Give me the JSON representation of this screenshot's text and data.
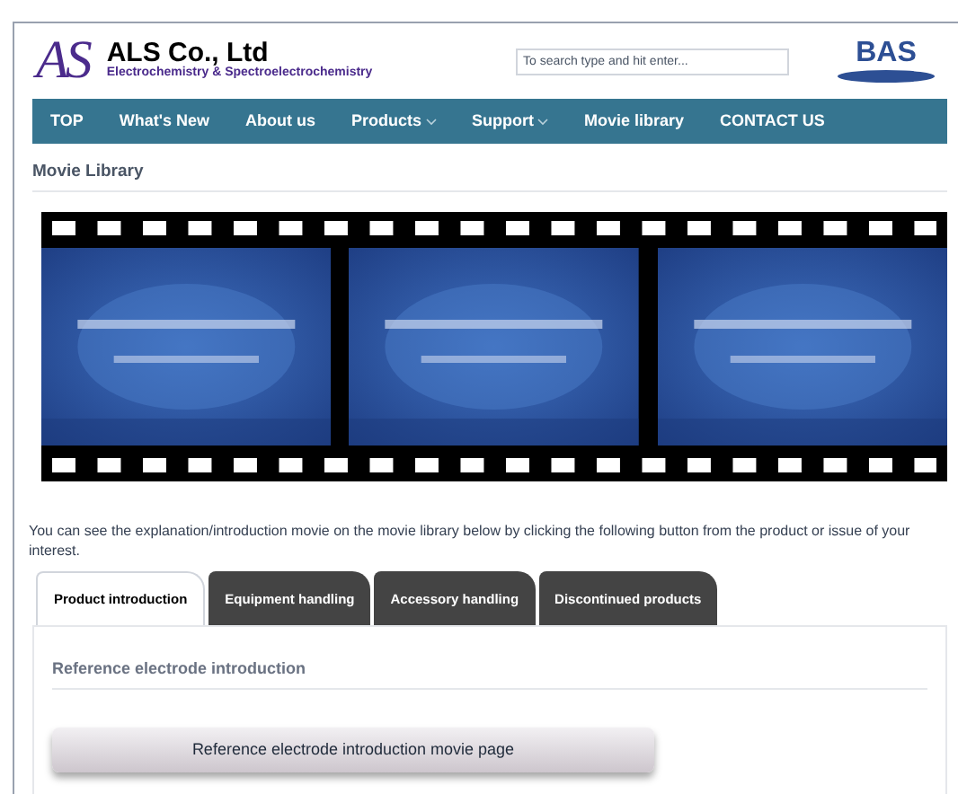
{
  "header": {
    "logo_text": "AS",
    "company": "ALS Co., Ltd",
    "tagline": "Electrochemistry & Spectroelectrochemistry",
    "search": {
      "placeholder": "To search type and hit enter..."
    },
    "partner_logo": "BAS"
  },
  "nav": [
    {
      "label": "TOP",
      "dropdown": false
    },
    {
      "label": "What's New",
      "dropdown": false
    },
    {
      "label": "About us",
      "dropdown": false
    },
    {
      "label": "Products",
      "dropdown": true
    },
    {
      "label": "Support",
      "dropdown": true
    },
    {
      "label": "Movie library",
      "dropdown": false
    },
    {
      "label": "CONTACT US",
      "dropdown": false
    }
  ],
  "page_title": "Movie Library",
  "intro": "You can see the explanation/introduction movie on the movie library below by clicking the following button from the product or issue of your interest.",
  "tabs": [
    {
      "label": "Product introduction",
      "selected": true
    },
    {
      "label": "Equipment handling",
      "selected": false
    },
    {
      "label": "Accessory handling",
      "selected": false
    },
    {
      "label": "Discontinued products",
      "selected": false
    }
  ],
  "panel": {
    "heading": "Reference electrode introduction",
    "button": "Reference electrode introduction movie page"
  }
}
